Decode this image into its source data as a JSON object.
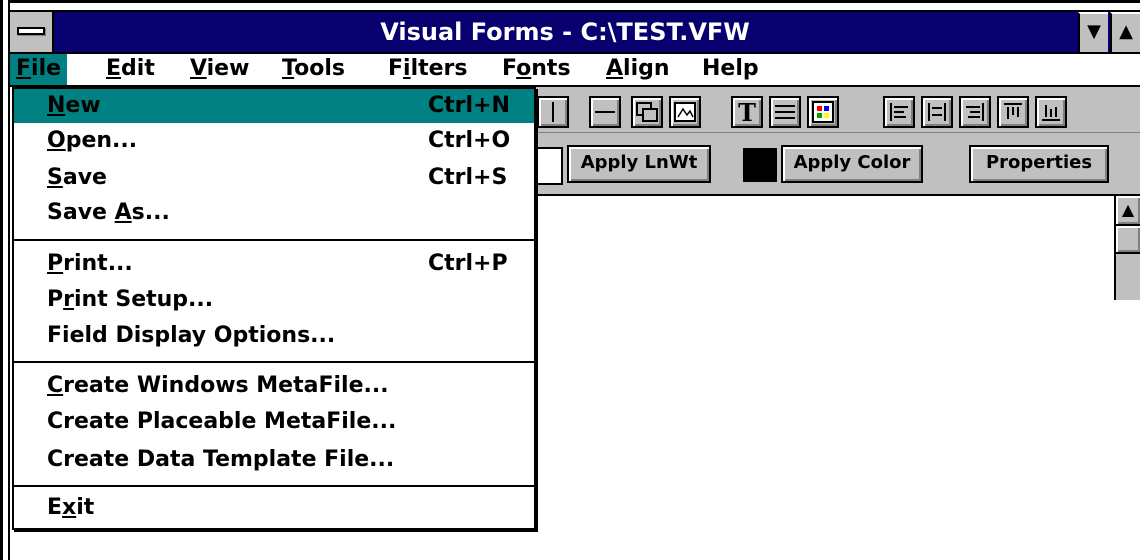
{
  "window": {
    "title": "Visual Forms - C:\\TEST.VFW",
    "minimize_glyph": "▼",
    "maximize_glyph": "▲"
  },
  "menubar": {
    "items": [
      {
        "label": "File",
        "mnemonic": "F",
        "rest": "ile"
      },
      {
        "label": "Edit",
        "mnemonic": "E",
        "rest": "dit"
      },
      {
        "label": "View",
        "mnemonic": "V",
        "rest": "iew"
      },
      {
        "label": "Tools",
        "mnemonic": "T",
        "rest": "ools"
      },
      {
        "label": "Filters",
        "pre": "F",
        "mnemonic": "i",
        "rest": "lters"
      },
      {
        "label": "Fonts",
        "pre": "F",
        "mnemonic": "o",
        "rest": "nts"
      },
      {
        "label": "Align",
        "mnemonic": "A",
        "rest": "lign"
      },
      {
        "label": "Help",
        "mnemonic": "",
        "rest": "Help"
      }
    ]
  },
  "file_menu": {
    "items": [
      {
        "pre": "",
        "mnemonic": "N",
        "rest": "ew",
        "shortcut": "Ctrl+N"
      },
      {
        "pre": "",
        "mnemonic": "O",
        "rest": "pen...",
        "shortcut": "Ctrl+O"
      },
      {
        "pre": "",
        "mnemonic": "S",
        "rest": "ave",
        "shortcut": "Ctrl+S"
      },
      {
        "pre": "Save ",
        "mnemonic": "A",
        "rest": "s...",
        "shortcut": ""
      },
      {
        "pre": "",
        "mnemonic": "P",
        "rest": "rint...",
        "shortcut": "Ctrl+P"
      },
      {
        "pre": "P",
        "mnemonic": "r",
        "rest": "int Setup...",
        "shortcut": ""
      },
      {
        "pre": "Field Display Options...",
        "mnemonic": "",
        "rest": "",
        "shortcut": ""
      },
      {
        "pre": "",
        "mnemonic": "C",
        "rest": "reate Windows MetaFile...",
        "shortcut": ""
      },
      {
        "pre": "Create Placeable MetaFile...",
        "mnemonic": "",
        "rest": "",
        "shortcut": ""
      },
      {
        "pre": "Create Data Template File...",
        "mnemonic": "",
        "rest": "",
        "shortcut": ""
      },
      {
        "pre": "E",
        "mnemonic": "x",
        "rest": "it",
        "shortcut": ""
      }
    ]
  },
  "toolbar": {
    "apply_lnwt": "Apply LnWt",
    "apply_color": "Apply Color",
    "properties": "Properties",
    "text_tool_glyph": "T"
  },
  "colors": {
    "titlebar": "#08006e",
    "highlight": "#008080",
    "face": "#c0c0c0"
  }
}
